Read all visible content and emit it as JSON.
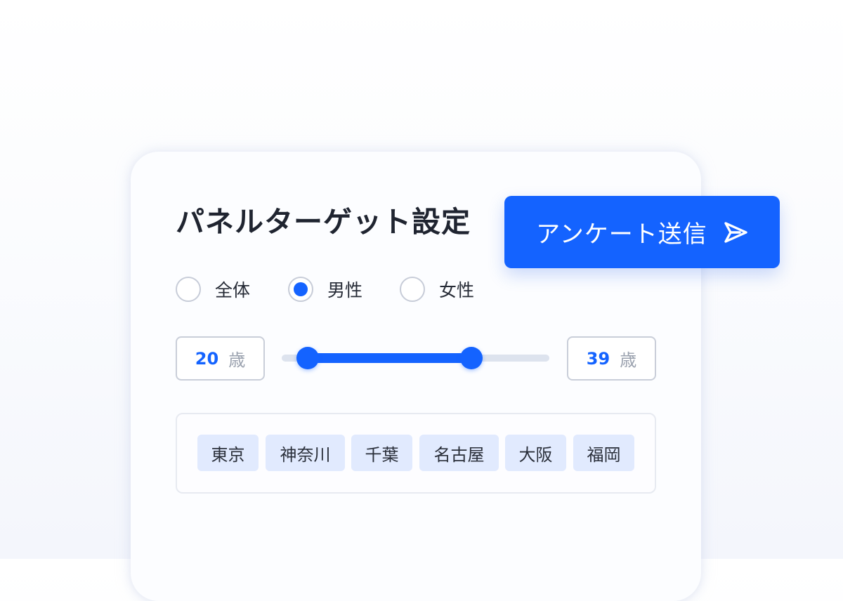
{
  "panel": {
    "title": "パネルターゲット設定"
  },
  "submit": {
    "label": "アンケート送信",
    "icon": "send-icon"
  },
  "gender": {
    "options": [
      {
        "label": "全体",
        "selected": false
      },
      {
        "label": "男性",
        "selected": true
      },
      {
        "label": "女性",
        "selected": false
      }
    ]
  },
  "age": {
    "min": "20",
    "max": "39",
    "unit": "歳"
  },
  "regions": [
    "東京",
    "神奈川",
    "千葉",
    "名古屋",
    "大阪",
    "福岡"
  ],
  "colors": {
    "accent": "#1463ff",
    "tag_bg": "#e1eafe",
    "border": "#c9ced9"
  }
}
